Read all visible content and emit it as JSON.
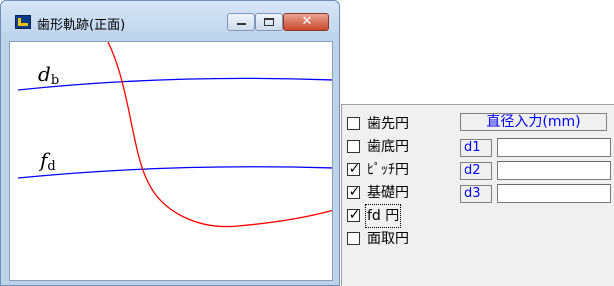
{
  "window": {
    "title": "歯形軌跡(正面)",
    "buttons": {
      "minimize": "minimize",
      "maximize": "maximize",
      "close": "✕"
    }
  },
  "plot": {
    "labels": [
      {
        "id": "db",
        "main": "d",
        "sub": "b"
      },
      {
        "id": "fd",
        "main": "f",
        "sub": "d"
      }
    ]
  },
  "panel": {
    "checkboxes": [
      {
        "label": "歯先円",
        "checked": false
      },
      {
        "label": "歯底円",
        "checked": false
      },
      {
        "label": "ﾋﾟｯﾁ円",
        "checked": true
      },
      {
        "label": "基礎円",
        "checked": true
      },
      {
        "label": "fd 円",
        "checked": true
      },
      {
        "label": "面取円",
        "checked": false
      }
    ],
    "input_header": "直径入力(mm)",
    "inputs": [
      {
        "label": "d1",
        "value": ""
      },
      {
        "label": "d2",
        "value": ""
      },
      {
        "label": "d3",
        "value": ""
      }
    ]
  },
  "colors": {
    "curve_blue": "#0000ff",
    "curve_red": "#ff0000"
  }
}
